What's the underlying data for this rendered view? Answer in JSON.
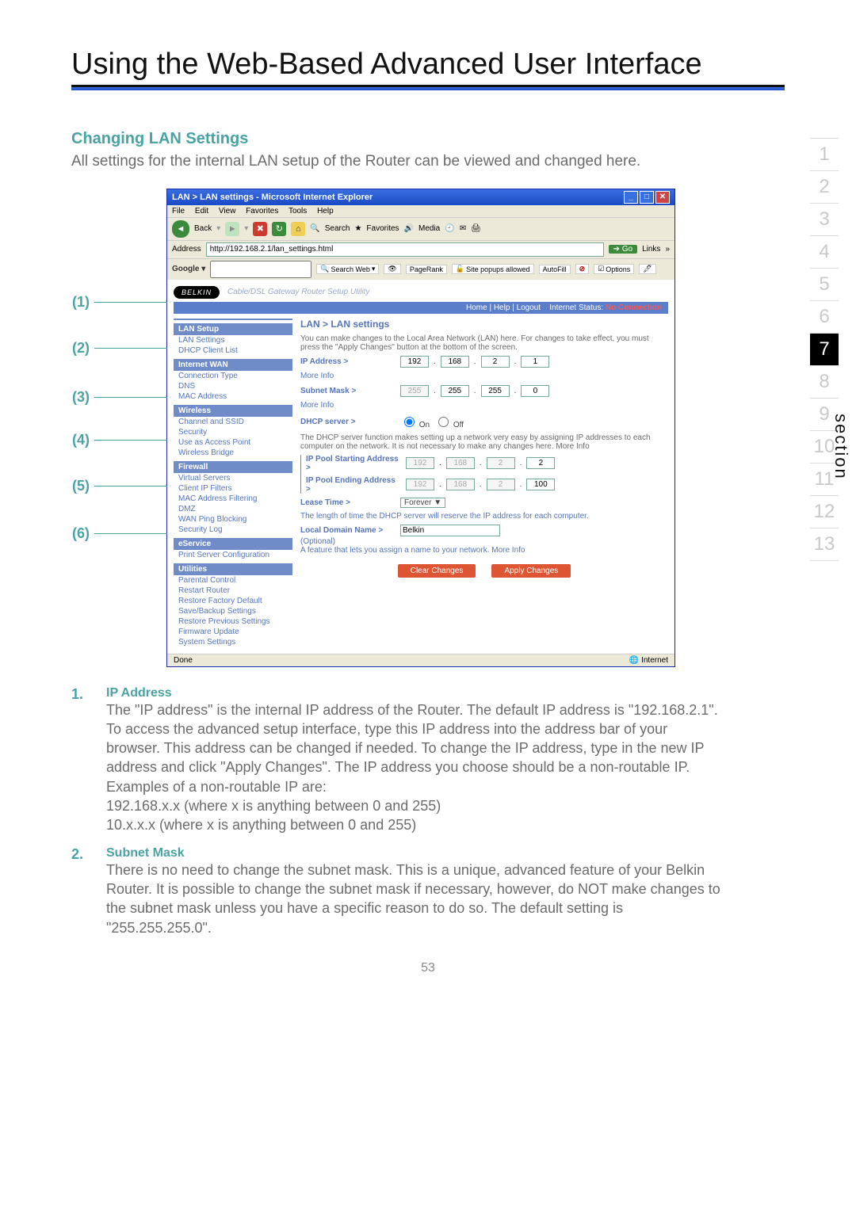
{
  "page_title": "Using the Web-Based Advanced User Interface",
  "heading": "Changing LAN Settings",
  "lead": "All settings for the internal LAN setup of the Router can be viewed and changed here.",
  "page_number": "53",
  "side_label": "section",
  "side_nav": [
    "1",
    "2",
    "3",
    "4",
    "5",
    "6",
    "7",
    "8",
    "9",
    "10",
    "11",
    "12",
    "13"
  ],
  "side_nav_active": "7",
  "callouts": [
    "(1)",
    "(2)",
    "(3)",
    "(4)",
    "(5)",
    "(6)"
  ],
  "ie": {
    "title": "LAN > LAN settings - Microsoft Internet Explorer",
    "menus": [
      "File",
      "Edit",
      "View",
      "Favorites",
      "Tools",
      "Help"
    ],
    "toolbar": {
      "back": "Back",
      "search": "Search",
      "favorites": "Favorites",
      "media": "Media"
    },
    "address_label": "Address",
    "address_value": "http://192.168.2.1/lan_settings.html",
    "go": "Go",
    "links": "Links",
    "google": "Google",
    "google_btns": {
      "search_web": "Search Web",
      "page_rank": "PageRank",
      "popups": "Site popups allowed",
      "autofill": "AutoFill",
      "options": "Options"
    },
    "statusbar": {
      "done": "Done",
      "zone": "Internet"
    }
  },
  "belkin": {
    "logo": "BELKIN",
    "tag": "Cable/DSL Gateway Router Setup Utility",
    "strip": {
      "home": "Home",
      "help": "Help",
      "logout": "Logout",
      "istat_label": "Internet Status:",
      "istat_value": "No Connection"
    }
  },
  "leftnav": {
    "lan_setup": "LAN Setup",
    "lan_settings": "LAN Settings",
    "dhcp_client_list": "DHCP Client List",
    "internet_wan": "Internet WAN",
    "connection_type": "Connection Type",
    "dns": "DNS",
    "mac_address": "MAC Address",
    "wireless": "Wireless",
    "channel_ssid": "Channel and SSID",
    "security_w": "Security",
    "use_as_ap": "Use as Access Point",
    "wbridge": "Wireless Bridge",
    "firewall": "Firewall",
    "virtual_servers": "Virtual Servers",
    "client_ip_filters": "Client IP Filters",
    "mac_filtering": "MAC Address Filtering",
    "dmz": "DMZ",
    "wan_ping": "WAN Ping Blocking",
    "security_log": "Security Log",
    "eservice": "eService",
    "print_server": "Print Server Configuration",
    "utilities": "Utilities",
    "parental": "Parental Control",
    "restart": "Restart Router",
    "factory": "Restore Factory Default",
    "save_backup": "Save/Backup Settings",
    "restore_prev": "Restore Previous Settings",
    "fw_update": "Firmware Update",
    "system_settings": "System Settings"
  },
  "form": {
    "title": "LAN > LAN settings",
    "intro": "You can make changes to the Local Area Network (LAN) here. For changes to take effect, you must press the \"Apply Changes\" button at the bottom of the screen.",
    "ip_label": "IP Address >",
    "ip": [
      "192",
      "168",
      "2",
      "1"
    ],
    "more_info": "More Info",
    "subnet_label": "Subnet Mask >",
    "subnet": [
      "255",
      "255",
      "255",
      "0"
    ],
    "dhcp_label": "DHCP server >",
    "dhcp_on": "On",
    "dhcp_off": "Off",
    "dhcp_explain": "The DHCP server function makes setting up a network very easy by assigning IP addresses to each computer on the network. It is not necessary to make any changes here. More Info",
    "pool_start": "IP Pool Starting Address >",
    "pool_start_vals": [
      "192",
      "168",
      "2",
      "2"
    ],
    "pool_end": "IP Pool Ending Address >",
    "pool_end_vals": [
      "192",
      "168",
      "2",
      "100"
    ],
    "lease_label": "Lease Time >",
    "lease_value": "Forever",
    "lease_explain": "The length of time the DHCP server will reserve the IP address for each computer.",
    "domain_label": "Local Domain Name >",
    "domain_value": "Belkin",
    "domain_opt": "(Optional)",
    "domain_explain": "A feature that lets you assign a name to your network. More Info",
    "clear": "Clear Changes",
    "apply": "Apply Changes"
  },
  "sections": [
    {
      "num": "1.",
      "title": "IP Address",
      "body": "The \"IP address\" is the internal IP address of the Router. The default IP address is \"192.168.2.1\". To access the advanced setup interface, type this IP address into the address bar of your browser. This address can be changed if needed. To change the IP address, type in the new IP address and click \"Apply Changes\". The IP address you choose should be a non-routable IP. Examples of a non-routable IP are:\n192.168.x.x (where x is anything between 0 and 255)\n10.x.x.x (where x is anything between 0 and 255)"
    },
    {
      "num": "2.",
      "title": "Subnet Mask",
      "body": "There is no need to change the subnet mask. This is a unique, advanced feature of your Belkin Router. It is possible to change the subnet mask if necessary, however, do NOT make changes to the subnet mask unless you have a specific reason to do so. The default setting is \"255.255.255.0\"."
    }
  ]
}
